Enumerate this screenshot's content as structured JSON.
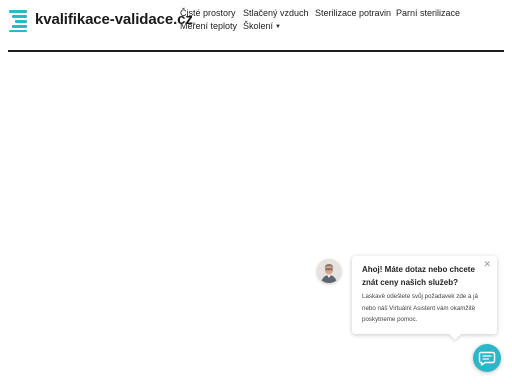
{
  "site": {
    "logo_text": "kvalifikace-validace.cz",
    "brand_color": "#2ab8c9"
  },
  "nav": {
    "items": [
      {
        "label": "Čisté prostory"
      },
      {
        "label": "Stlačený vzduch"
      },
      {
        "label": "Sterilizace potravin"
      },
      {
        "label": "Parní sterilizace"
      },
      {
        "label": "Měření teploty"
      },
      {
        "label": "Školení"
      }
    ]
  },
  "chat": {
    "title": "Ahoj! Máte dotaz nebo chcete znát ceny našich služeb?",
    "body": "Laskavě odešlete svůj požadavek zde a já nebo náš Virtuální Asistent vám okamžitě poskytneme pomoc.",
    "close_icon": "close-icon",
    "button_icon": "chat-icon"
  }
}
